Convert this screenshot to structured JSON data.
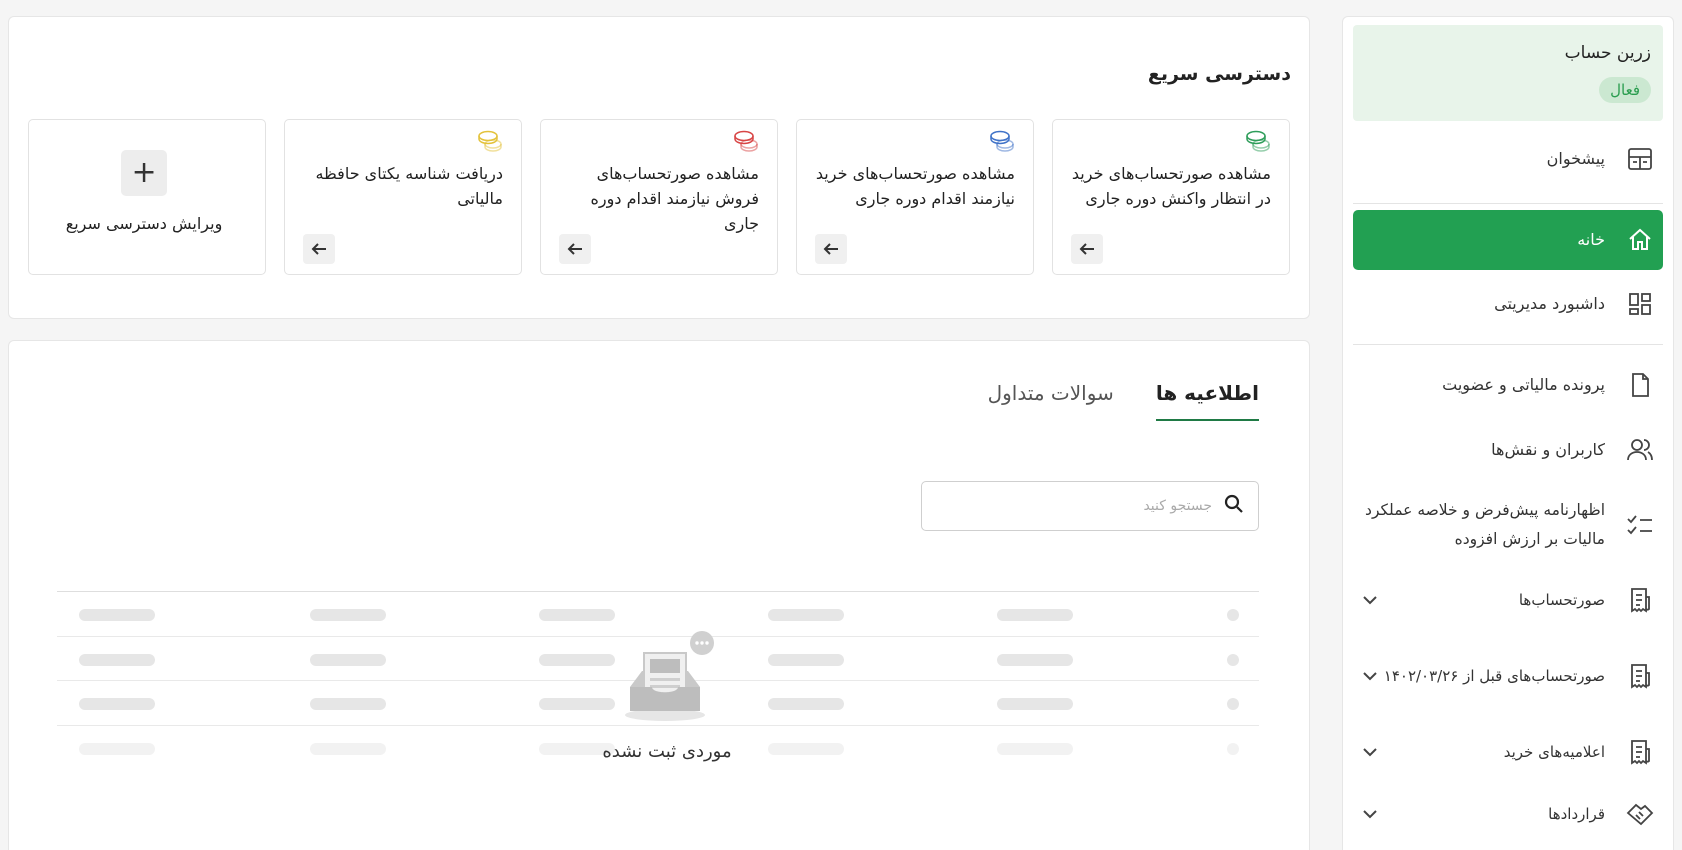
{
  "sidebar": {
    "account": {
      "name": "زرین حساب",
      "status": "فعال"
    },
    "items": [
      {
        "label": "پیشخوان",
        "icon": "dashboard-panel-icon"
      },
      {
        "label": "خانه",
        "icon": "home-icon",
        "active": true
      },
      {
        "label": "داشبورد مدیریتی",
        "icon": "grid-dashboard-icon"
      },
      {
        "label": "پرونده مالیاتی و عضویت",
        "icon": "file-icon"
      },
      {
        "label": "کاربران و نقش‌ها",
        "icon": "users-icon"
      },
      {
        "label": "اظهارنامه پیش‌فرض و خلاصه عملکرد مالیات بر ارزش افزوده",
        "icon": "checklist-icon"
      },
      {
        "label": "صورتحساب‌ها",
        "icon": "receipt-icon",
        "expandable": true
      },
      {
        "label": "صورتحساب‌های قبل از ۱۴۰۲/۰۳/۲۶",
        "icon": "receipt-icon",
        "expandable": true
      },
      {
        "label": "اعلامیه‌های خرید",
        "icon": "receipt-icon",
        "expandable": true
      },
      {
        "label": "قراردادها",
        "icon": "handshake-icon",
        "expandable": true
      }
    ]
  },
  "quick_access": {
    "title": "دسترسی سریع",
    "cards": [
      {
        "text": "مشاهده صورتحساب‌های خرید در انتظار واکنش دوره جاری",
        "coin_color": "#2e9d5a"
      },
      {
        "text": "مشاهده صورتحساب‌های خرید نیازمند اقدام دوره جاری",
        "coin_color": "#3f72c8"
      },
      {
        "text": "مشاهده صورتحساب‌های فروش نیازمند اقدام دوره جاری",
        "coin_color": "#d84545"
      },
      {
        "text": "دریافت شناسه یکتای حافظه مالیاتی",
        "coin_color": "#e3c23a"
      }
    ],
    "edit_label": "ویرایش دسترسی سریع",
    "edit_symbol": "+"
  },
  "news": {
    "tabs": [
      {
        "label": "اطلاعیه ها",
        "active": true
      },
      {
        "label": "سوالات متداول",
        "active": false
      }
    ],
    "search_placeholder": "جستجو کنید",
    "empty_label": "موردی ثبت نشده"
  },
  "colors": {
    "primary": "#22a052",
    "active_badge_bg": "#cbe8d1",
    "account_bg": "#e8f4ea"
  }
}
